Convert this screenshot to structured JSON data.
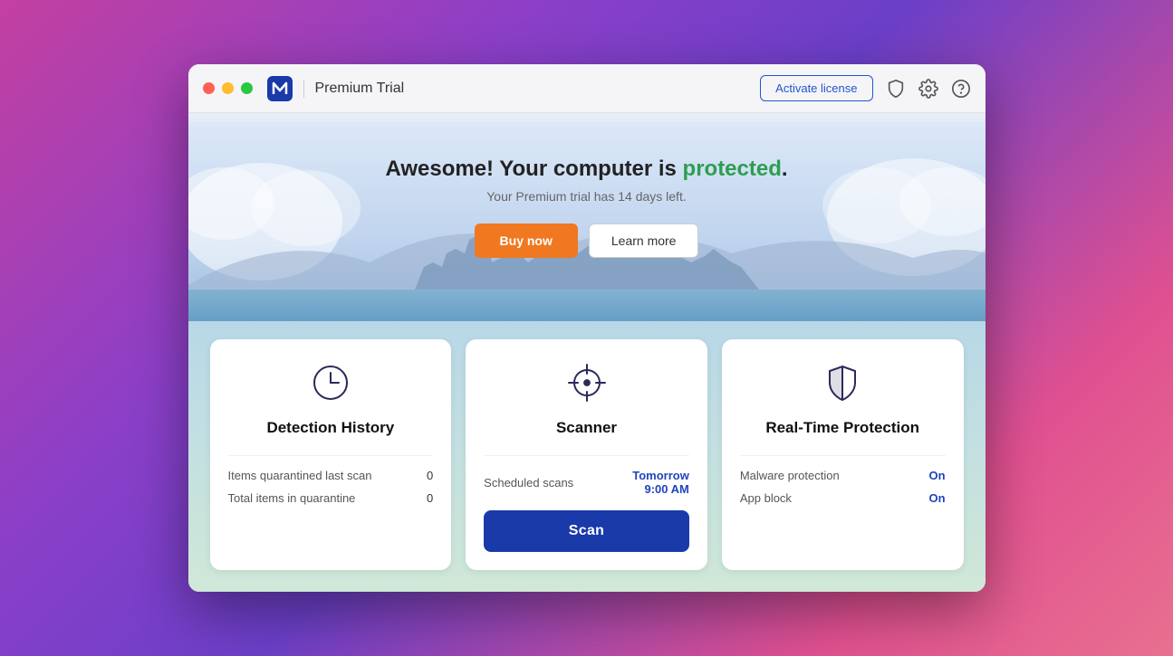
{
  "window": {
    "controls": {
      "close_label": "",
      "minimize_label": "",
      "maximize_label": ""
    },
    "titlebar": {
      "app_name": "Premium Trial",
      "activate_btn": "Activate license"
    },
    "hero": {
      "title_prefix": "Awesome! Your computer is ",
      "title_highlight": "protected",
      "title_suffix": ".",
      "subtitle": "Your Premium trial has 14 days left.",
      "buy_btn": "Buy now",
      "learn_btn": "Learn more"
    },
    "cards": [
      {
        "id": "detection-history",
        "title": "Detection History",
        "icon": "clock",
        "rows": [
          {
            "label": "Items quarantined last scan",
            "value": "0"
          },
          {
            "label": "Total items in quarantine",
            "value": "0"
          }
        ]
      },
      {
        "id": "scanner",
        "title": "Scanner",
        "icon": "crosshair",
        "rows": [
          {
            "label": "Scheduled scans",
            "value": "Tomorrow\n9:00 AM",
            "blue": true
          }
        ],
        "scan_btn": "Scan"
      },
      {
        "id": "real-time-protection",
        "title": "Real-Time Protection",
        "icon": "shield",
        "rows": [
          {
            "label": "Malware protection",
            "value": "On",
            "on": true
          },
          {
            "label": "App block",
            "value": "On",
            "on": true
          }
        ]
      }
    ]
  }
}
